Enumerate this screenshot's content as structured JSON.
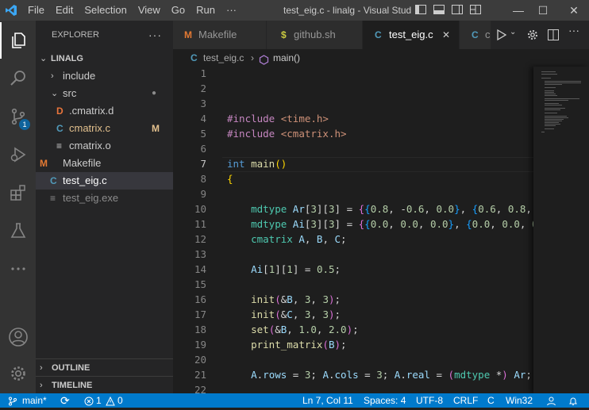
{
  "titlebar": {
    "menus": [
      "File",
      "Edit",
      "Selection",
      "View",
      "Go",
      "Run",
      "···"
    ],
    "title": "test_eig.c - linalg - Visual Studio Code",
    "min": "—",
    "max": "☐",
    "close": "✕"
  },
  "activity": {
    "source_control_badge": "1"
  },
  "explorer": {
    "header": "EXPLORER",
    "more": "···",
    "root": "LINALG",
    "items": [
      {
        "label": "include",
        "type": "folder"
      },
      {
        "label": "src",
        "type": "folder",
        "dot": "●"
      },
      {
        "label": ".cmatrix.d",
        "icon": "D",
        "icon_color": "#e8743b"
      },
      {
        "label": "cmatrix.c",
        "icon": "C",
        "icon_color": "#519aba",
        "status": "M"
      },
      {
        "label": "cmatrix.o",
        "icon": "≡",
        "icon_color": "#cccccc"
      },
      {
        "label": "Makefile",
        "icon": "M",
        "icon_color": "#e37933"
      },
      {
        "label": "test_eig.c",
        "icon": "C",
        "icon_color": "#519aba"
      },
      {
        "label": "test_eig.exe",
        "icon": "≡",
        "icon_color": "#8c8c8c"
      }
    ],
    "outline": "OUTLINE",
    "timeline": "TIMELINE"
  },
  "tabs": [
    {
      "label": "Makefile",
      "icon": "M",
      "icon_color": "#e37933"
    },
    {
      "label": "github.sh",
      "icon": "$",
      "icon_color": "#cbcb41"
    },
    {
      "label": "test_eig.c",
      "icon": "C",
      "icon_color": "#519aba",
      "close": "✕"
    },
    {
      "label": "c",
      "icon": "C",
      "icon_color": "#519aba"
    }
  ],
  "breadcrumb": {
    "file": "test_eig.c",
    "sep": "›",
    "symbol": "main()"
  },
  "editor": {
    "line_numbers": [
      "1",
      "2",
      "3",
      "4",
      "5",
      "6",
      "7",
      "8",
      "9",
      "10",
      "11",
      "12",
      "13",
      "14",
      "15",
      "16",
      "17",
      "18",
      "19",
      "20",
      "21",
      "22"
    ]
  },
  "status": {
    "branch": "main*",
    "sync": "⟳",
    "errors": "1",
    "warnings": "0",
    "position": "Ln 7, Col 11",
    "spaces": "Spaces: 4",
    "encoding": "UTF-8",
    "eol": "CRLF",
    "language": "C",
    "platform": "Win32"
  }
}
